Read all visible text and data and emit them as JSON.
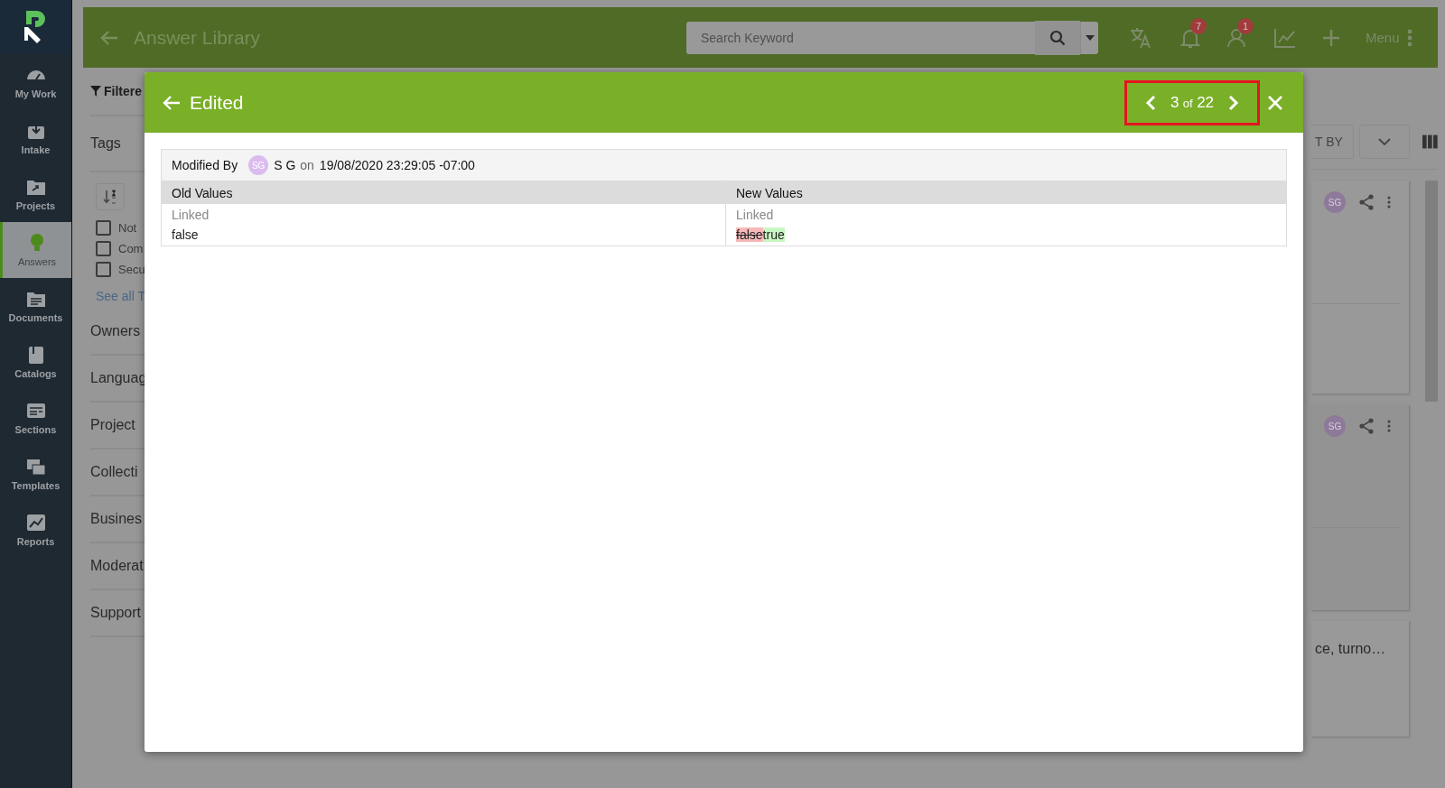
{
  "sidebar": {
    "items": [
      {
        "label": "My Work",
        "selected": false
      },
      {
        "label": "Intake",
        "selected": false
      },
      {
        "label": "Projects",
        "selected": false
      },
      {
        "label": "Answers",
        "selected": true
      },
      {
        "label": "Documents",
        "selected": false
      },
      {
        "label": "Catalogs",
        "selected": false
      },
      {
        "label": "Sections",
        "selected": false
      },
      {
        "label": "Templates",
        "selected": false
      },
      {
        "label": "Reports",
        "selected": false
      }
    ]
  },
  "topbar": {
    "title": "Answer Library",
    "search": {
      "placeholder": "Search Keyword"
    },
    "notifications_badge": "7",
    "requests_badge": "1",
    "menu_label": "Menu"
  },
  "filters": {
    "filtered_label": "Filtere",
    "tags_heading": "Tags",
    "tag_options": [
      {
        "label": "Not",
        "checked": false
      },
      {
        "label": "Com",
        "checked": false
      },
      {
        "label": "Secu",
        "checked": false
      }
    ],
    "see_all": "See all T",
    "sections": [
      "Owners",
      "Languag",
      "Project",
      "Collecti",
      "Busines",
      "Moderat",
      "Support"
    ]
  },
  "sort": {
    "label": "T BY"
  },
  "cards": [
    {
      "avatar": "SG"
    },
    {
      "avatar": "SG"
    },
    {
      "snippet": "ce, turno…"
    }
  ],
  "modal": {
    "title": "Edited",
    "pager": {
      "current": "3",
      "of": "of",
      "total": "22",
      "highlighted": true
    },
    "modified_by_label": "Modified By",
    "avatar": "SG",
    "user": "S G",
    "on": "on",
    "timestamp": "19/08/2020 23:29:05 -07:00",
    "columns": [
      "Old Values",
      "New Values"
    ],
    "old_values": [
      {
        "kind": "label",
        "text": "Linked"
      },
      {
        "kind": "value",
        "text": "false"
      }
    ],
    "new_values": [
      {
        "kind": "label",
        "text": "Linked"
      },
      {
        "kind": "diff",
        "removed": "false",
        "added": "true"
      }
    ]
  }
}
